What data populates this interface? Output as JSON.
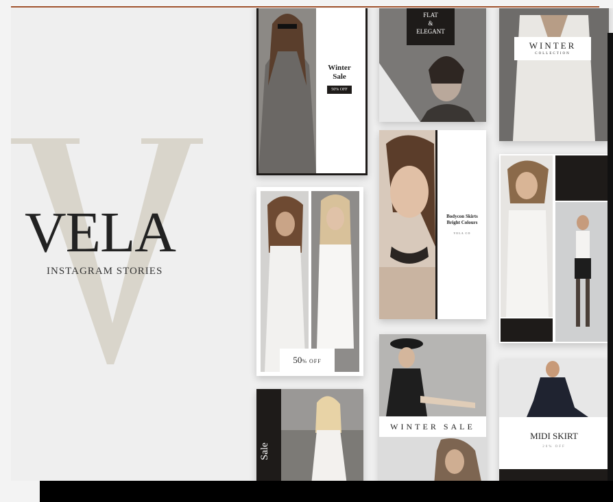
{
  "brand": {
    "initial": "V",
    "title": "VELA",
    "subtitle": "INSTAGRAM STORIES"
  },
  "cards": {
    "winter_sale": {
      "title_line1": "Winter",
      "title_line2": "Sale",
      "badge": "50% OFF"
    },
    "flat_elegant": {
      "line1": "FLAT",
      "line2": "&",
      "line3": "ELEGANT"
    },
    "winter_collection": {
      "title": "WINTER",
      "sub": "COLLECTION"
    },
    "bodycon": {
      "line1": "Bodycon Skirts",
      "line2": "Bright Colours",
      "small": "VELA CO"
    },
    "fifty_off": {
      "big": "50",
      "rest": "% OFF"
    },
    "winter_sale_banner": {
      "text": "WINTER SALE"
    },
    "midi_skirt": {
      "title": "MIDI SKIRT",
      "sub": "20% OFF"
    },
    "vertical_sale": {
      "text": "Sale"
    }
  },
  "colors": {
    "accent_line": "#a0522d",
    "beige": "#d9d5cb",
    "dark": "#1e1b19"
  }
}
